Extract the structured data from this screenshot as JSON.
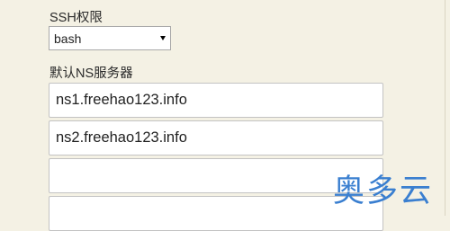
{
  "ssh": {
    "label": "SSH权限",
    "selected": "bash"
  },
  "ns": {
    "label": "默认NS服务器",
    "servers": [
      "ns1.freehao123.info",
      "ns2.freehao123.info",
      "",
      ""
    ]
  },
  "watermark": {
    "text": "奥多云"
  },
  "colors": {
    "background": "#f4f1e4",
    "watermark": "#3a7fd0"
  }
}
